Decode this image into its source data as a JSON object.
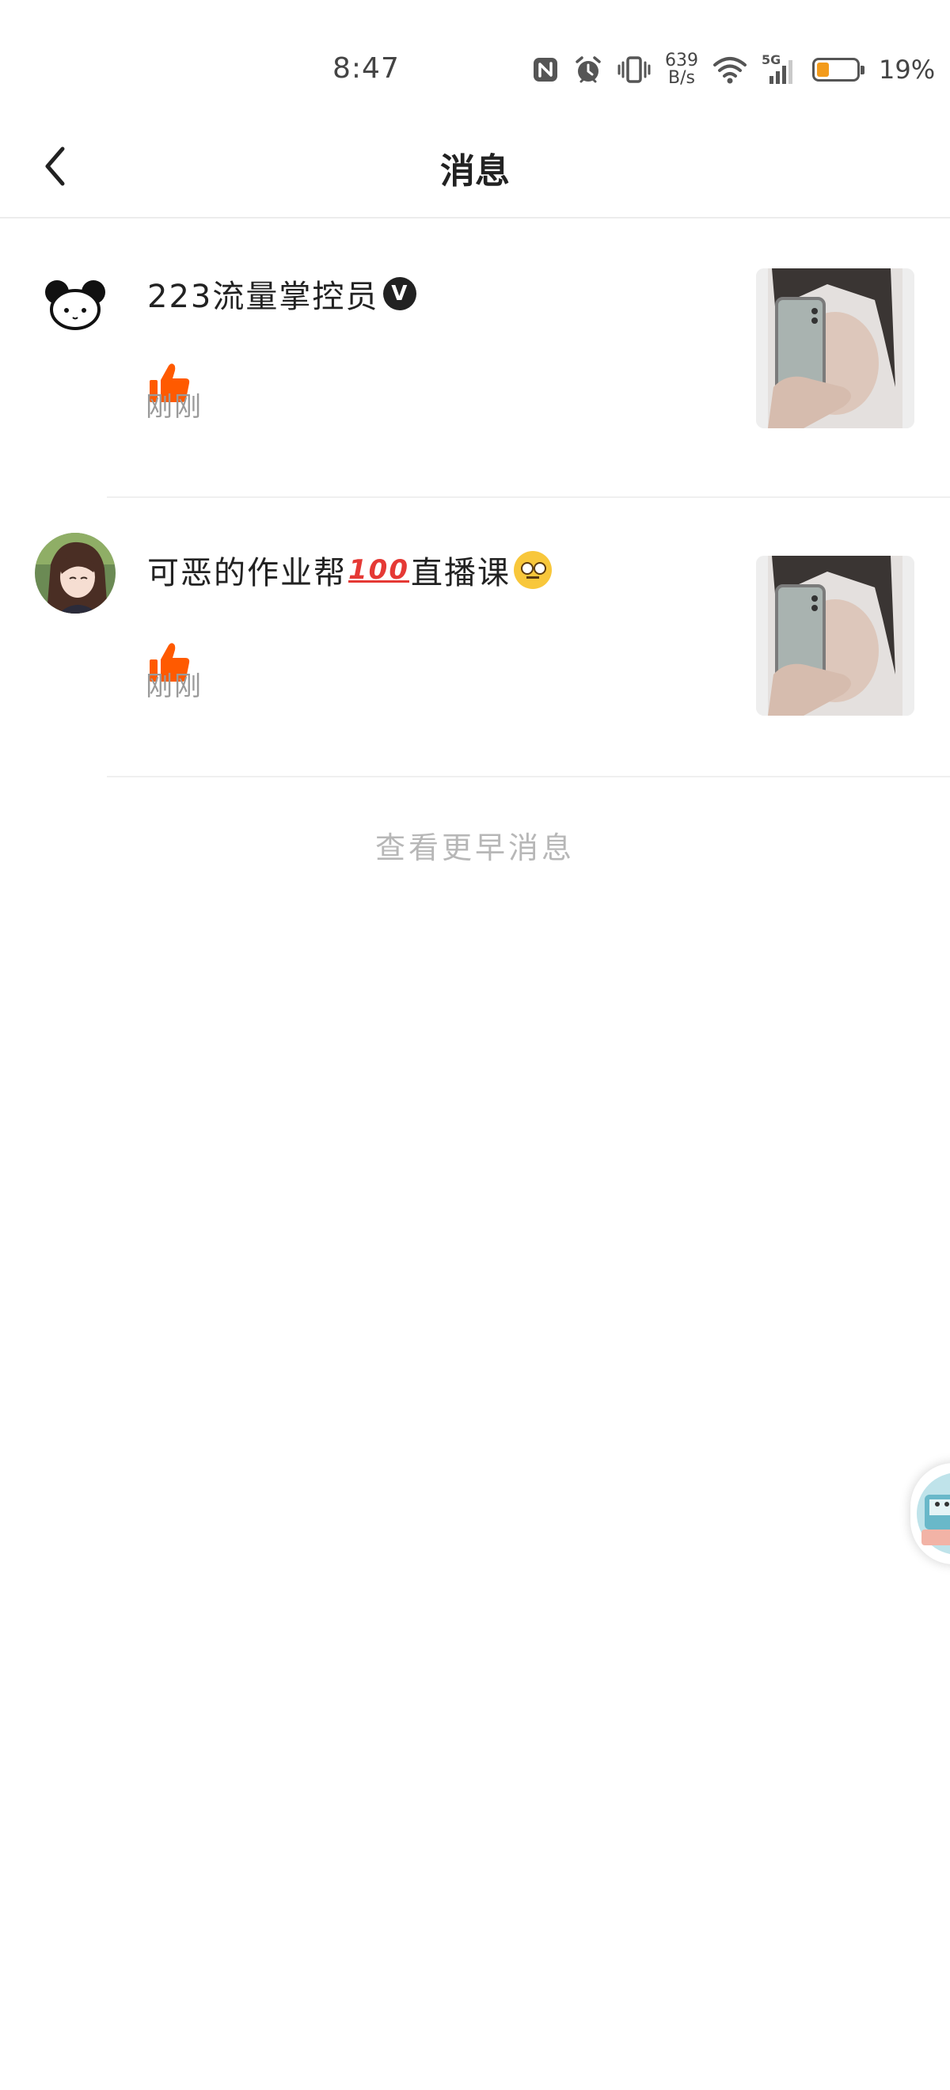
{
  "status_bar": {
    "time": "8:47",
    "net_speed_value": "639",
    "net_speed_unit": "B/s",
    "network_type": "5G",
    "battery_percent_text": "19%",
    "battery_level": 0.19,
    "icons": [
      "nfc-icon",
      "alarm-icon",
      "vibrate-icon",
      "wifi-icon",
      "signal-icon",
      "battery-icon"
    ]
  },
  "header": {
    "title": "消息",
    "back_icon": "chevron-left-icon"
  },
  "messages": [
    {
      "username": "223流量掌控员",
      "verified_badge": "V",
      "action_icon": "thumbs-up-icon",
      "time": "刚刚"
    },
    {
      "username_text": "可恶的作业帮",
      "username_emoji_100": "100",
      "username_tail": "直播课",
      "action_icon": "thumbs-up-icon",
      "time": "刚刚"
    }
  ],
  "view_earlier_label": "查看更早消息",
  "colors": {
    "like_orange": "#ff5a00",
    "text_primary": "#222222",
    "text_secondary": "#9a9a9a",
    "view_earlier": "#b7b7b7",
    "battery_fill": "#f39b1b"
  }
}
